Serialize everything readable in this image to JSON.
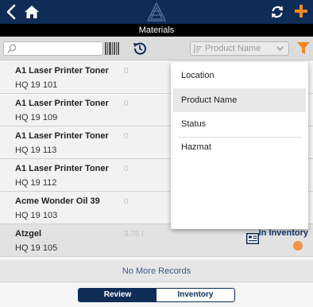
{
  "header": {
    "title": "Materials"
  },
  "toolbar": {
    "search_placeholder": "",
    "sort_selected": "Product Name"
  },
  "colors": {
    "navy": "#0e2c55",
    "accent_orange": "#f08a1c",
    "status_dot": "#f0924a"
  },
  "icons": [
    "back-icon",
    "home-icon",
    "logo-icon",
    "refresh-icon",
    "plus-icon",
    "search-icon",
    "barcode-icon",
    "history-icon",
    "sort-icon",
    "chevron-down-icon",
    "filter-icon",
    "document-icon"
  ],
  "rows": [
    {
      "name": "A1 Laser Printer Toner",
      "code": "HQ 19 101",
      "qty": "0",
      "status": ""
    },
    {
      "name": "A1 Laser Printer Toner",
      "code": "HQ 19 109",
      "qty": "0",
      "status": ""
    },
    {
      "name": "A1 Laser Printer Toner",
      "code": "HQ 19 113",
      "qty": "0",
      "status": ""
    },
    {
      "name": "A1 Laser Printer Toner",
      "code": "HQ 19 112",
      "qty": "0",
      "status": ""
    },
    {
      "name": "Acme Wonder Oil 39",
      "code": "HQ 19 103",
      "qty": "0",
      "status": ""
    },
    {
      "name": "Atzgel",
      "code": "HQ 19 105",
      "qty": "3.75 l",
      "status": "In Inventory"
    }
  ],
  "footer": {
    "no_more": "No More Records"
  },
  "tabs": [
    {
      "label": "Review",
      "active": true
    },
    {
      "label": "Inventory",
      "active": false
    }
  ],
  "dropdown": {
    "options": [
      "Location",
      "Product Name",
      "Status",
      "Hazmat"
    ],
    "highlighted": "Product Name"
  }
}
